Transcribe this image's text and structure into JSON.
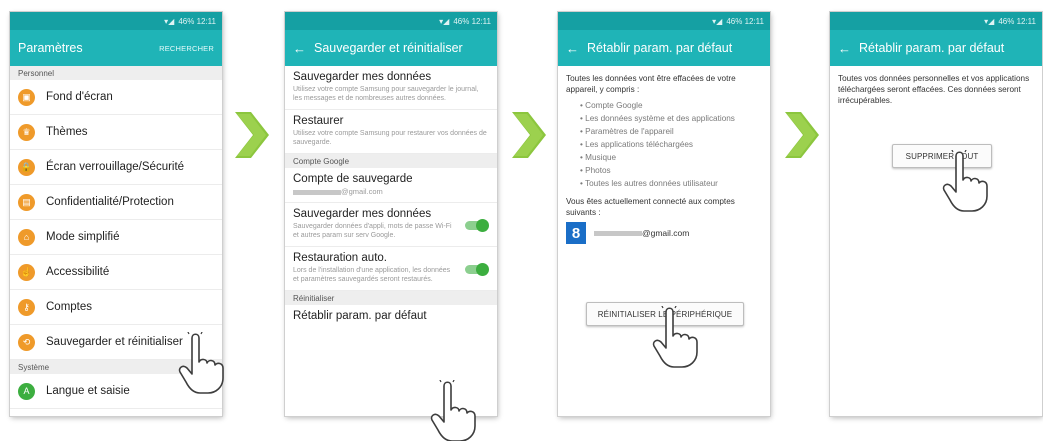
{
  "status_bar": {
    "text": "46% 12:11"
  },
  "screen1": {
    "title": "Paramètres",
    "action": "RECHERCHER",
    "section_personnel": "Personnel",
    "items": [
      {
        "label": "Fond d'écran",
        "icon": "wallpaper-icon",
        "glyph": "▣"
      },
      {
        "label": "Thèmes",
        "icon": "themes-icon",
        "glyph": "♛"
      },
      {
        "label": "Écran verrouillage/Sécurité",
        "icon": "lock-icon",
        "glyph": "🔒"
      },
      {
        "label": "Confidentialité/Protection",
        "icon": "privacy-icon",
        "glyph": "▤"
      },
      {
        "label": "Mode simplifié",
        "icon": "home-icon",
        "glyph": "⌂"
      },
      {
        "label": "Accessibilité",
        "icon": "accessibility-icon",
        "glyph": "☝"
      },
      {
        "label": "Comptes",
        "icon": "key-icon",
        "glyph": "⚷"
      },
      {
        "label": "Sauvegarder et réinitialiser",
        "icon": "backup-icon",
        "glyph": "⟲"
      }
    ],
    "section_systeme": "Système",
    "system_items": [
      {
        "label": "Langue et saisie",
        "icon": "language-icon",
        "glyph": "A"
      }
    ]
  },
  "screen2": {
    "title": "Sauvegarder et réinitialiser",
    "backup_title": "Sauvegarder mes données",
    "backup_desc": "Utilisez votre compte Samsung pour sauvegarder le journal, les messages et de nombreuses autres données.",
    "restore_title": "Restaurer",
    "restore_desc": "Utilisez votre compte Samsung pour restaurer vos données de sauvegarde.",
    "section_google": "Compte Google",
    "backup_account_title": "Compte de sauvegarde",
    "backup_account_email": "@gmail.com",
    "backup_google_title": "Sauvegarder mes données",
    "backup_google_desc": "Sauvegarder données d'appli, mots de passe Wi-Fi et autres param sur serv Google.",
    "auto_restore_title": "Restauration auto.",
    "auto_restore_desc": "Lors de l'installation d'une application, les données et paramètres sauvegardés seront restaurés.",
    "section_reset": "Réinitialiser",
    "factory_reset_title": "Rétablir param. par défaut"
  },
  "screen3": {
    "title": "Rétablir param. par défaut",
    "intro": "Toutes les données vont être effacées de votre appareil, y compris :",
    "bullets": [
      "Compte Google",
      "Les données système et des applications",
      "Paramètres de l'appareil",
      "Les applications téléchargées",
      "Musique",
      "Photos",
      "Toutes les autres données utilisateur"
    ],
    "connected_text": "Vous êtes actuellement connecté aux comptes suivants :",
    "google_glyph": "8",
    "account_email": "@gmail.com",
    "reset_button": "RÉINITIALISER LE PÉRIPHÉRIQUE"
  },
  "screen4": {
    "title": "Rétablir param. par défaut",
    "message": "Toutes vos données personnelles et vos applications téléchargées seront effacées. Ces données seront irrécupérables.",
    "delete_button": "SUPPRIMER TOUT"
  },
  "colors": {
    "status_bar": "#15a0a3",
    "app_bar": "#1fb4b7",
    "arrow": "#8cc63e",
    "icon_orange": "#ef9a2a",
    "icon_green": "#3cae3f"
  }
}
